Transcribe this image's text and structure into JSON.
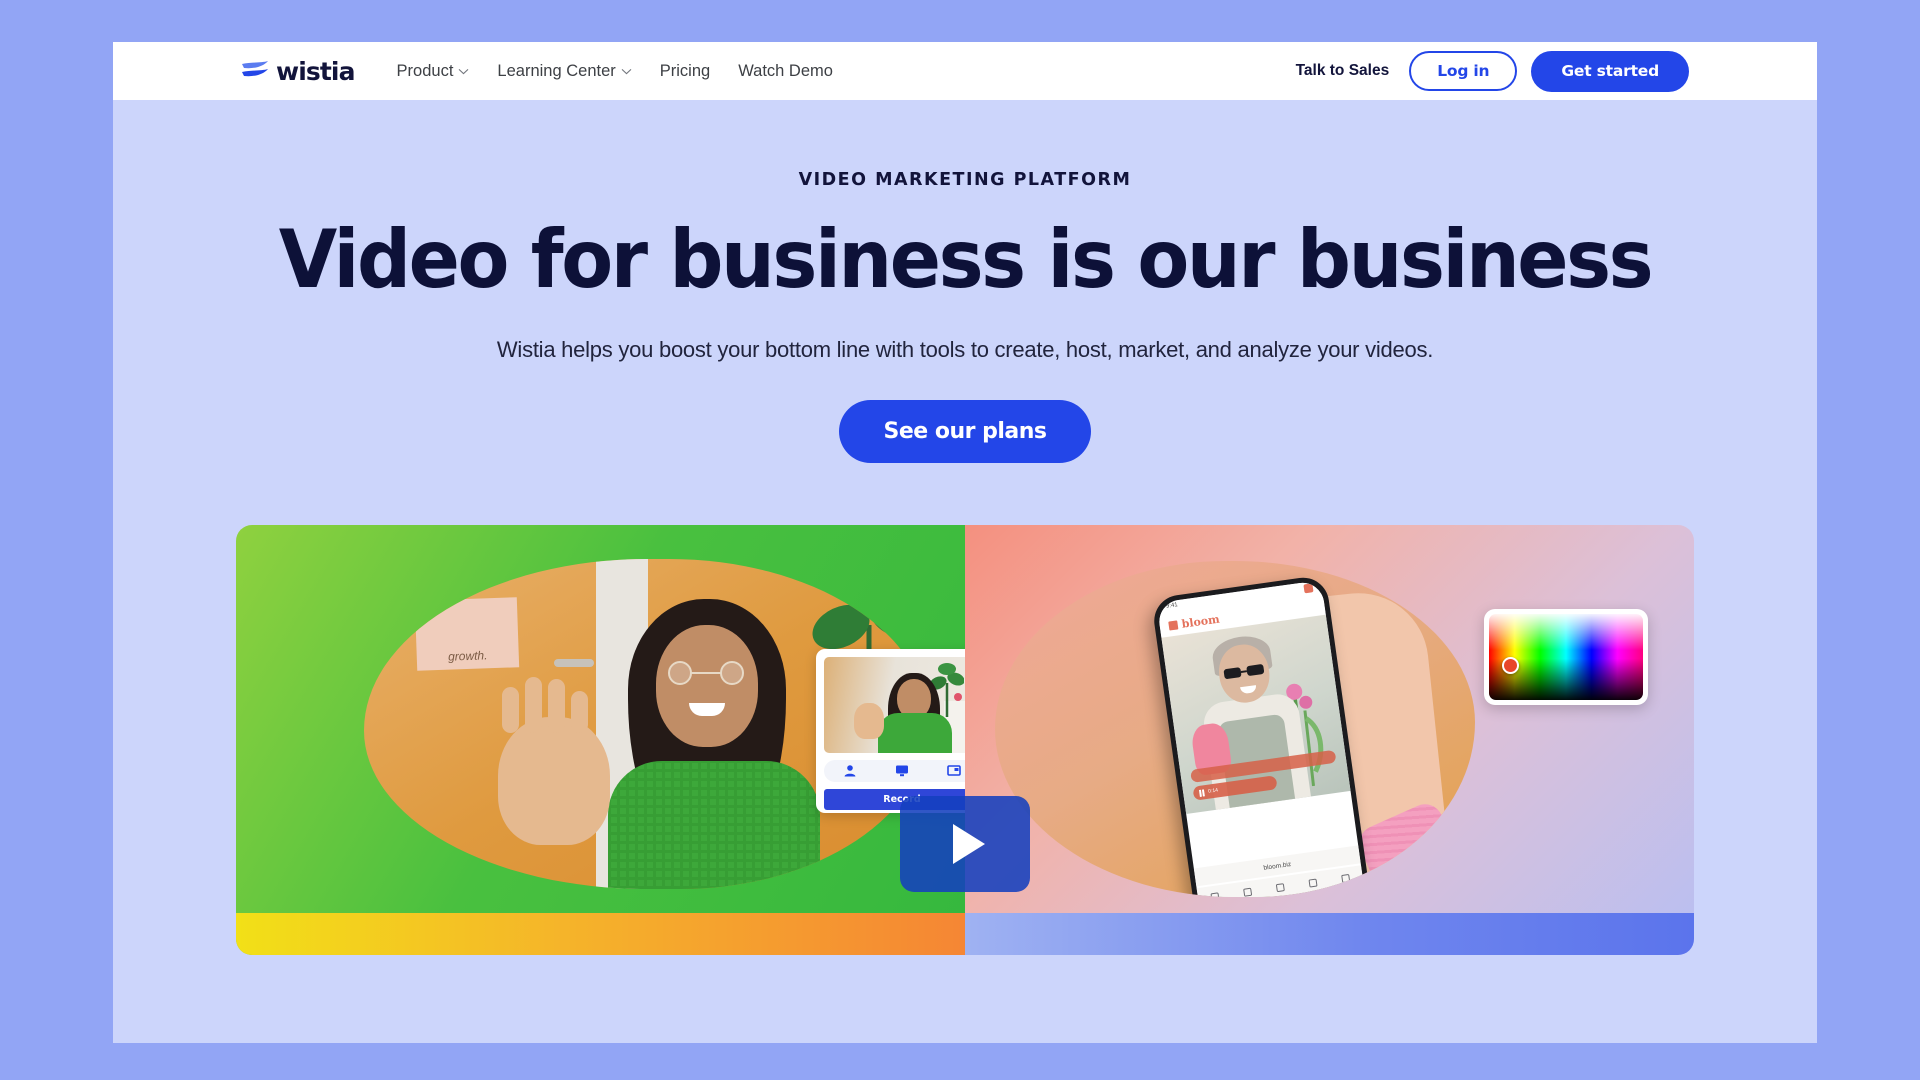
{
  "brand": {
    "name": "wistia",
    "logo_icon": "wistia-wave-logo-icon",
    "accent_color": "#2346e8",
    "dark_color": "#0d1138",
    "hero_bg_color": "#ccd5fb",
    "page_border_color": "#92a5f5"
  },
  "header": {
    "nav_items": [
      {
        "label": "Product",
        "has_dropdown": true,
        "icon": "chevron-down-icon"
      },
      {
        "label": "Learning Center",
        "has_dropdown": true,
        "icon": "chevron-down-icon"
      },
      {
        "label": "Pricing",
        "has_dropdown": false
      },
      {
        "label": "Watch Demo",
        "has_dropdown": false
      }
    ],
    "talk_to_sales": "Talk to Sales",
    "login_label": "Log in",
    "get_started_label": "Get started"
  },
  "hero": {
    "eyebrow": "VIDEO MARKETING PLATFORM",
    "headline": "Video for business is our business",
    "subhead": "Wistia helps you boost your bottom line with tools to create, host, market, and analyze your videos.",
    "cta_label": "See our plans"
  },
  "media": {
    "play_icon": "play-triangle-icon",
    "left_panel": {
      "poster_text": "growth.",
      "record_widget": {
        "options": [
          {
            "icon": "person-camera-icon",
            "name": "webcam"
          },
          {
            "icon": "screen-monitor-icon",
            "name": "screen"
          },
          {
            "icon": "window-capture-icon",
            "name": "window"
          }
        ],
        "record_label": "Record"
      }
    },
    "right_panel": {
      "phone": {
        "site_name": "bloom",
        "site_logo_icon": "bloom-flower-icon",
        "status_time": "9:41",
        "url": "bloom.biz",
        "player_time": "0:14"
      },
      "color_picker": {
        "name": "color-picker",
        "selected_color": "#e8462b"
      }
    }
  }
}
